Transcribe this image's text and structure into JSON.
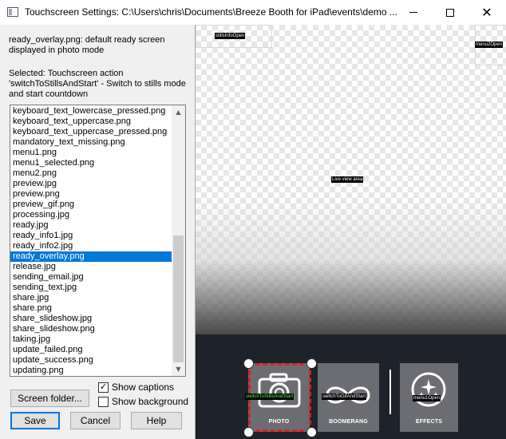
{
  "window": {
    "title": "Touchscreen Settings: C:\\Users\\chris\\Documents\\Breeze Booth for iPad\\events\\demo ..."
  },
  "left_panel": {
    "description": "ready_overlay.png: default ready screen displayed in photo mode",
    "selected_action": "Selected: Touchscreen action 'switchToStillsAndStart' - Switch to stills mode and start countdown",
    "file_list": [
      "keyboard_text_lowercase_pressed.png",
      "keyboard_text_uppercase.png",
      "keyboard_text_uppercase_pressed.png",
      "mandatory_text_missing.png",
      "menu1.png",
      "menu1_selected.png",
      "menu2.png",
      "preview.jpg",
      "preview.png",
      "preview_gif.png",
      "processing.jpg",
      "ready.jpg",
      "ready_info1.jpg",
      "ready_info2.jpg",
      "ready_overlay.png",
      "release.jpg",
      "sending_email.jpg",
      "sending_text.jpg",
      "share.jpg",
      "share.png",
      "share_slideshow.jpg",
      "share_slideshow.png",
      "taking.jpg",
      "update_failed.png",
      "update_success.png",
      "updating.png"
    ],
    "selected_index": 14,
    "buttons": {
      "screen_folder": "Screen folder...",
      "save": "Save",
      "cancel": "Cancel",
      "help": "Help"
    },
    "checkboxes": {
      "show_captions": {
        "label": "Show captions",
        "checked": true
      },
      "show_background": {
        "label": "Show background",
        "checked": false
      }
    }
  },
  "preview": {
    "captions": {
      "stills_info": "stillsInfoOpen",
      "menu2": "menu2Open",
      "live_view": "Live view area",
      "switch_stills": "switchToStillsAndStart",
      "switch_gif": "switchToGifAndStart",
      "menu1": "menu1Open"
    },
    "tiles": {
      "photo": "PHOTO",
      "boomerang": "BOOMERANG",
      "effects": "EFFECTS"
    },
    "colors": {
      "bottom_bar": "#1d222b",
      "tile": "#6b6d72",
      "selection_dash": "#e02020",
      "selected_caption": "#55ff55"
    }
  }
}
